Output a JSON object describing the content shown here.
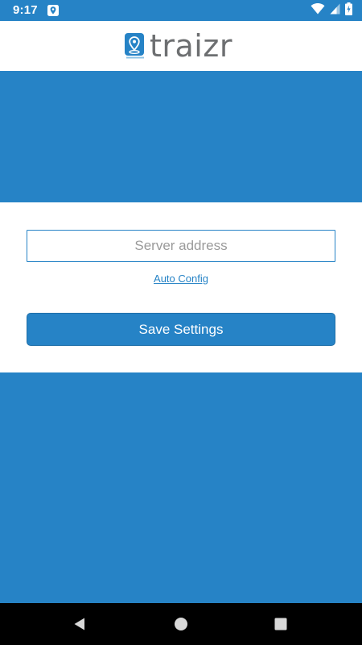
{
  "status_bar": {
    "time": "9:17",
    "notification_icon": "location-pin-icon",
    "icons": [
      "wifi-icon",
      "signal-icon",
      "battery-charging-icon"
    ]
  },
  "header": {
    "logo_text": "traizr",
    "logo_icon": "map-pin-logo-icon"
  },
  "form": {
    "server_input": {
      "value": "",
      "placeholder": "Server address"
    },
    "auto_config_label": "Auto Config",
    "save_label": "Save Settings"
  },
  "nav_bar": {
    "buttons": [
      "back-icon",
      "home-icon",
      "recents-icon"
    ]
  },
  "colors": {
    "primary_blue": "#2683c6",
    "logo_gray": "#6d6f71",
    "white": "#ffffff",
    "nav_black": "#000000"
  }
}
